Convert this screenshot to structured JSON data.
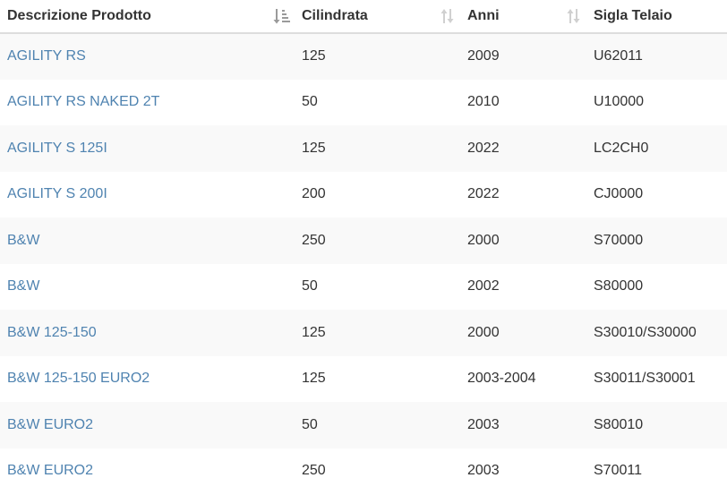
{
  "table": {
    "headers": [
      {
        "label": "Descrizione Prodotto",
        "sort_state": "active-ascending",
        "icon": "sort-alpha-asc-icon"
      },
      {
        "label": "Cilindrata",
        "sort_state": "unsorted",
        "icon": "sort-icon"
      },
      {
        "label": "Anni",
        "sort_state": "unsorted",
        "icon": "sort-icon"
      },
      {
        "label": "Sigla Telaio",
        "sort_state": "none",
        "icon": ""
      }
    ],
    "rows": [
      {
        "descrizione": "AGILITY RS",
        "cilindrata": "125",
        "anni": "2009",
        "sigla": "U62011"
      },
      {
        "descrizione": "AGILITY RS NAKED 2T",
        "cilindrata": "50",
        "anni": "2010",
        "sigla": "U10000"
      },
      {
        "descrizione": "AGILITY S 125I",
        "cilindrata": "125",
        "anni": "2022",
        "sigla": "LC2CH0"
      },
      {
        "descrizione": "AGILITY S 200I",
        "cilindrata": "200",
        "anni": "2022",
        "sigla": "CJ0000"
      },
      {
        "descrizione": "B&W",
        "cilindrata": "250",
        "anni": "2000",
        "sigla": "S70000"
      },
      {
        "descrizione": "B&W",
        "cilindrata": "50",
        "anni": "2002",
        "sigla": "S80000"
      },
      {
        "descrizione": "B&W 125-150",
        "cilindrata": "125",
        "anni": "2000",
        "sigla": "S30010/S30000"
      },
      {
        "descrizione": "B&W 125-150 EURO2",
        "cilindrata": "125",
        "anni": "2003-2004",
        "sigla": "S30011/S30001"
      },
      {
        "descrizione": "B&W EURO2",
        "cilindrata": "50",
        "anni": "2003",
        "sigla": "S80010"
      },
      {
        "descrizione": "B&W EURO2",
        "cilindrata": "250",
        "anni": "2003",
        "sigla": "S70011"
      }
    ]
  },
  "colors": {
    "link": "#4f83b0",
    "text": "#333333",
    "stripe": "#f9f9f9",
    "active_sort_icon": "#9a9a9a",
    "inactive_sort_icon": "#d0d0d0"
  }
}
